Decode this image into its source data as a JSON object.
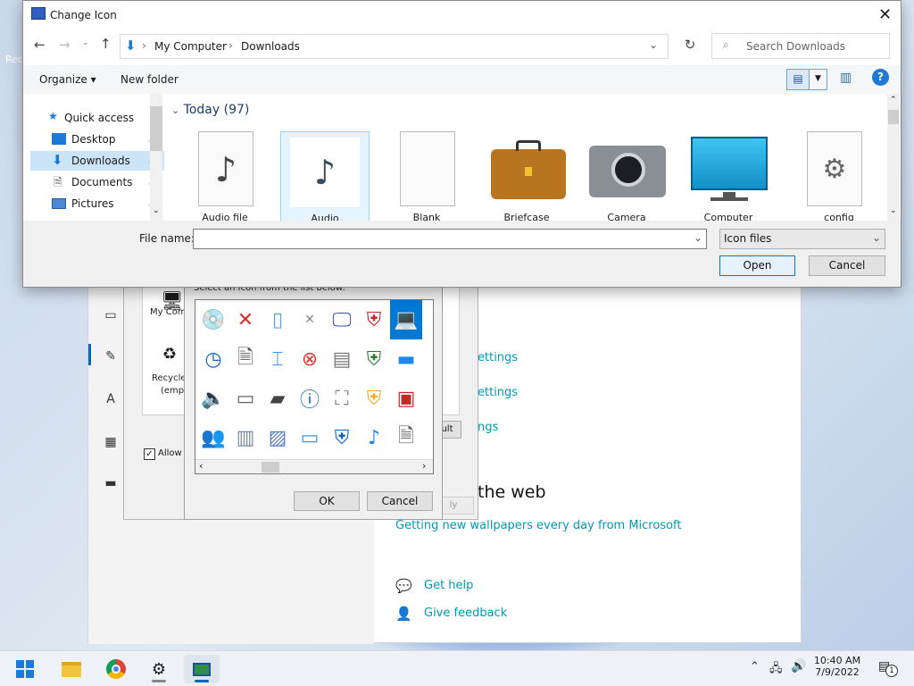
{
  "desktop": {
    "label": "Rec"
  },
  "settings": {
    "heading1": "ttings",
    "links1": [
      "ettings",
      "ettings",
      "ngs"
    ],
    "heading2": "the web",
    "wallpaper_link": "Getting new wallpapers every day from Microsoft",
    "help": "Get help",
    "feedback": "Give feedback"
  },
  "desktop_icons_dialog": {
    "icons": [
      "My Comp",
      "Recycle",
      "(empt"
    ],
    "allow": "Allow t",
    "default_btn": "ult",
    "apply_btn": "ly"
  },
  "change_icon_dialog": {
    "caption": "Select an icon from the list below:",
    "ok": "OK",
    "cancel": "Cancel"
  },
  "open_dialog": {
    "title": "Change Icon",
    "breadcrumb": [
      "My Computer",
      "Downloads"
    ],
    "search_placeholder": "Search Downloads",
    "organize": "Organize",
    "new_folder": "New folder",
    "nav": [
      {
        "label": "Quick access",
        "pinned": false
      },
      {
        "label": "Desktop",
        "pinned": true
      },
      {
        "label": "Downloads",
        "pinned": true,
        "selected": true
      },
      {
        "label": "Documents",
        "pinned": true
      },
      {
        "label": "Pictures",
        "pinned": true
      }
    ],
    "group": "Today (97)",
    "files": [
      "Audio file",
      "Audio",
      "Blank",
      "Briefcase",
      "Camera",
      "Computer",
      "config"
    ],
    "file_name_label": "File name:",
    "file_name_value": "",
    "file_type": "Icon files",
    "open_btn": "Open",
    "cancel_btn": "Cancel"
  },
  "taskbar": {
    "time": "10:40 AM",
    "date": "7/9/2022",
    "notifications": "1"
  },
  "colors": {
    "accent": "#0078d7",
    "link": "#0098b6",
    "selection": "#cce4f7"
  }
}
